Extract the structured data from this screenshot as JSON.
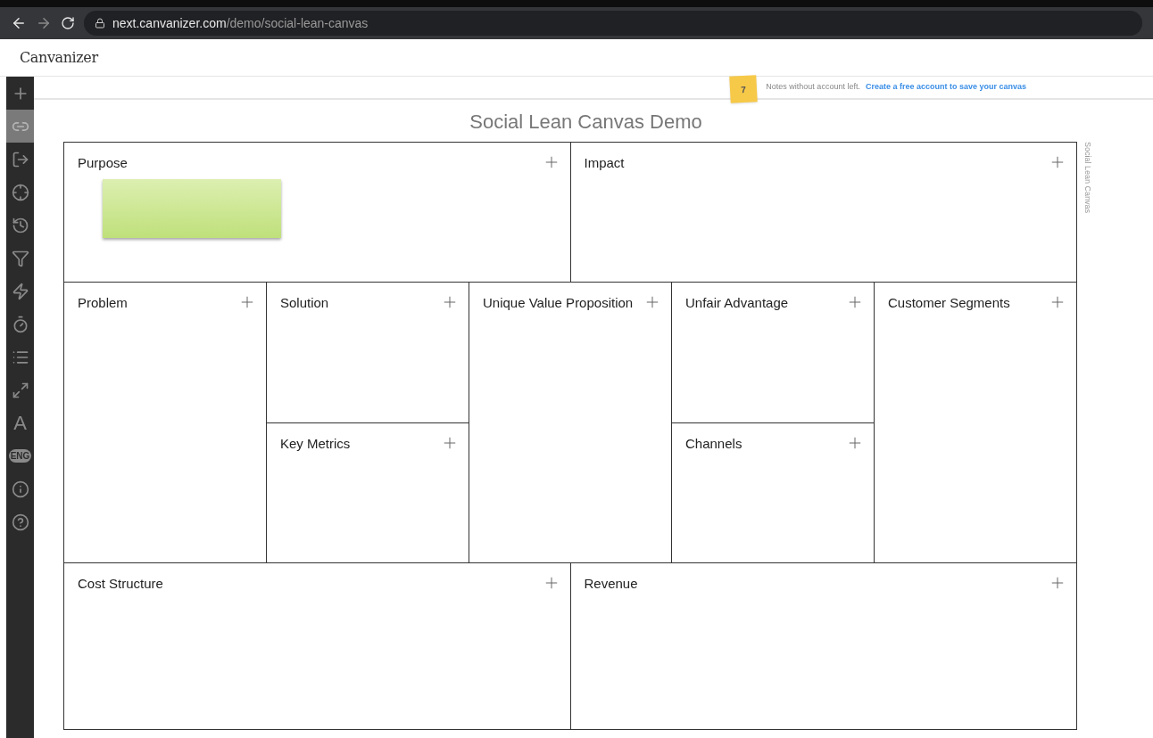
{
  "browser": {
    "url_host": "next.canvanizer.com",
    "url_path": "/demo/social-lean-canvas"
  },
  "logo": "Canvanizer",
  "tools": [
    {
      "kind": "plus",
      "selected": false
    },
    {
      "kind": "link",
      "selected": true
    },
    {
      "kind": "export",
      "selected": false
    },
    {
      "kind": "focus",
      "selected": false
    },
    {
      "kind": "history",
      "selected": false
    },
    {
      "kind": "filter",
      "selected": false
    },
    {
      "kind": "bolt",
      "selected": false
    },
    {
      "kind": "timer",
      "selected": false
    },
    {
      "kind": "list",
      "selected": false
    },
    {
      "kind": "expand",
      "selected": false
    },
    {
      "kind": "text",
      "label": "A",
      "selected": false
    },
    {
      "kind": "language",
      "label": "ENG",
      "selected": false
    },
    {
      "kind": "info",
      "selected": false
    },
    {
      "kind": "help",
      "selected": false
    }
  ],
  "notice": {
    "count": "7",
    "text": "Notes without account left.",
    "link": "Create a free account to save your canvas"
  },
  "title": "Social Lean Canvas Demo",
  "side_label": "Social Lean Canvas",
  "canvas": {
    "top": [
      {
        "title": "Purpose",
        "notes": [
          {
            "kind": "sticky"
          }
        ]
      },
      {
        "title": "Impact"
      }
    ],
    "middle": [
      [
        {
          "title": "Problem"
        }
      ],
      [
        {
          "title": "Solution"
        },
        {
          "title": "Key Metrics"
        }
      ],
      [
        {
          "title": "Unique Value Proposition"
        }
      ],
      [
        {
          "title": "Unfair Advantage"
        },
        {
          "title": "Channels"
        }
      ],
      [
        {
          "title": "Customer Segments"
        }
      ]
    ],
    "bottom": [
      {
        "title": "Cost Structure"
      },
      {
        "title": "Revenue"
      }
    ]
  }
}
